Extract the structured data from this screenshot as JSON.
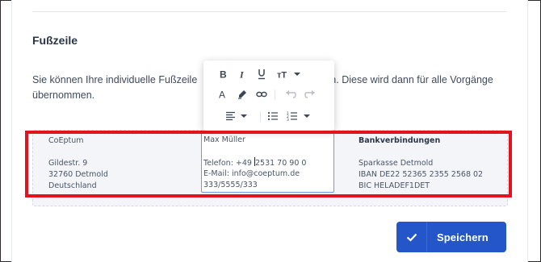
{
  "section": {
    "title": "Fußzeile",
    "description": "Sie können Ihre individuelle Fußzeile hier erstellen. Diese wird dann für alle Vorgänge übernommen.",
    "description_visible_start": "Sie können Ihre individuelle Fußzeile",
    "description_visible_end": "n. Diese wird dann für alle Vorgänge",
    "description_line2": "übernommen."
  },
  "footer": {
    "col1": [
      "CoEptum",
      "",
      "Gildestr. 9",
      "32760 Detmold",
      "Deutschland"
    ],
    "col2": [
      "Max Müller",
      "",
      "Telefon: +49 ",
      "2531 70 90 0",
      "E-Mail: info@coeptum.de",
      "333/5555/333"
    ],
    "col3": [
      "Bankverbindungen",
      "",
      "Sparkasse Detmold",
      "IBAN DE22 52365 2355 2568 02",
      "BIC HELADEF1DET"
    ]
  },
  "toolbar": {
    "buttons": [
      "bold-icon",
      "italic-icon",
      "underline-icon",
      "text-size-icon",
      "text-color-icon",
      "highlight-icon",
      "link-icon",
      "undo-icon",
      "redo-icon",
      "align-icon",
      "bullet-list-icon",
      "numbered-list-icon"
    ]
  },
  "actions": {
    "save_label": "Speichern"
  },
  "colors": {
    "primary": "#2456c9",
    "highlight_border": "#e3121b",
    "editor_border": "#6d9be6"
  }
}
